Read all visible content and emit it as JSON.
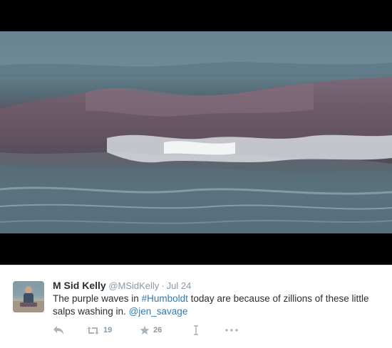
{
  "tweet": {
    "fullname": "M Sid Kelly",
    "handle": "@MSidKelly",
    "separator": "·",
    "time": "Jul 24",
    "text_part1": "The purple waves in ",
    "hashtag": "#Humboldt",
    "text_part2": " today are because of zillions of these little salps washing in. ",
    "mention": "@jen_savage"
  },
  "actions": {
    "reply_icon": "reply-icon",
    "retweet_icon": "retweet-icon",
    "retweet_count": "19",
    "favorite_icon": "star-icon",
    "favorite_count": "26",
    "cursor_icon": "text-cursor-icon",
    "more_icon": "more-icon"
  },
  "colors": {
    "link": "#2b7bb9",
    "icon": "#a8b5bf",
    "name": "#292f33",
    "meta": "#8899a6"
  }
}
